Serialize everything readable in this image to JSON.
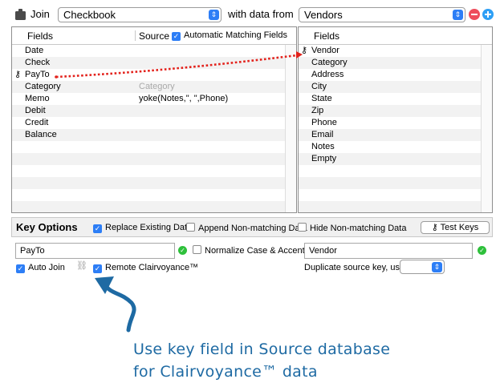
{
  "join": {
    "label": "Join",
    "target_db": "Checkbook",
    "with_label": "with data from",
    "source_db": "Vendors"
  },
  "left_panel": {
    "col_fields": "Fields",
    "col_source": "Source",
    "auto_match_label": "Automatic Matching Fields",
    "rows": [
      {
        "field": "Date",
        "source": ""
      },
      {
        "field": "Check",
        "source": ""
      },
      {
        "field": "PayTo",
        "source": ""
      },
      {
        "field": "Category",
        "source": "Category"
      },
      {
        "field": "Memo",
        "source": "yoke(Notes,\", \",Phone)"
      },
      {
        "field": "Debit",
        "source": ""
      },
      {
        "field": "Credit",
        "source": ""
      },
      {
        "field": "Balance",
        "source": ""
      }
    ]
  },
  "right_panel": {
    "col_fields": "Fields",
    "rows": [
      "Vendor",
      "Category",
      "Address",
      "City",
      "State",
      "Zip",
      "Phone",
      "Email",
      "Notes",
      "Empty"
    ]
  },
  "key_options": {
    "title": "Key Options",
    "replace_existing": "Replace Existing Data",
    "append_nonmatching": "Append Non-matching Data",
    "hide_nonmatching": "Hide Non-matching Data",
    "test_keys": "Test Keys",
    "left_key": "PayTo",
    "normalize": "Normalize Case & Accents",
    "right_key": "Vendor",
    "auto_join": "Auto Join",
    "remote_clairvoyance": "Remote Clairvoyance™",
    "duplicate_label": "Duplicate source key, use:",
    "duplicate_value": ""
  },
  "annotation": {
    "line1": "Use key field in Source database",
    "line2": "for Clairvoyance™ data"
  },
  "colors": {
    "accent": "#2d7ef6",
    "remove": "#ee4c5b",
    "add": "#2d9ff5",
    "link_line": "#e3221c",
    "annotation": "#1e6aa3"
  }
}
